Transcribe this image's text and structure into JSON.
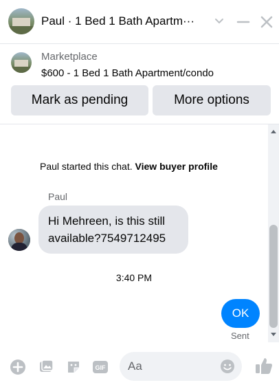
{
  "header": {
    "title": "Paul · 1 Bed 1 Bath Apartm···",
    "avatar_icon": "listing-photo",
    "chevron_icon": "chevron-down-icon",
    "minimize_icon": "minimize-icon",
    "close_icon": "close-icon"
  },
  "marketplace": {
    "source": "Marketplace",
    "listing": "$600 - 1 Bed 1 Bath Apartment/condo",
    "pending_button": "Mark as pending",
    "more_button": "More options"
  },
  "chat": {
    "system_text": "Paul started this chat.",
    "system_link": "View buyer profile",
    "sender_name": "Paul",
    "incoming_message_line1": "Hi Mehreen, is this still",
    "incoming_message_line2": "available?7549712495",
    "timestamp": "3:40 PM",
    "outgoing_message": "OK",
    "outgoing_status": "Sent"
  },
  "composer": {
    "placeholder": "Aa",
    "icons": [
      "plus-icon",
      "photo-icon",
      "sticker-icon",
      "gif-icon",
      "emoji-icon",
      "thumbs-up-icon"
    ]
  },
  "colors": {
    "accent": "#0084ff",
    "icon_gray": "#bcc0c4",
    "bubble_gray": "#e4e6eb"
  }
}
